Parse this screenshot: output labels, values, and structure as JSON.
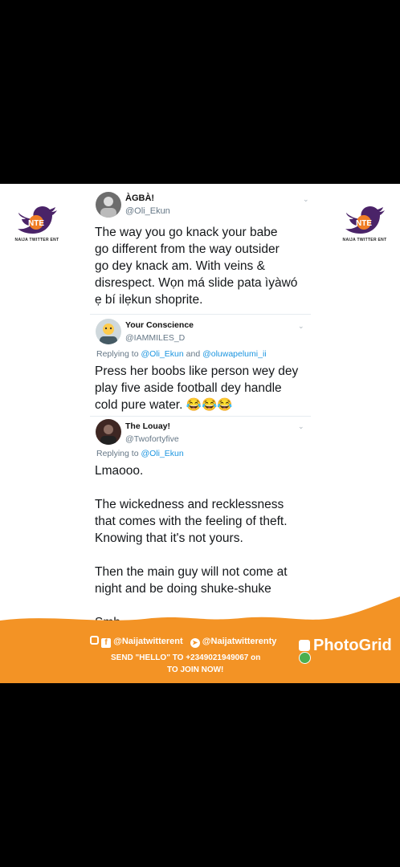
{
  "brand": {
    "logo_text": "NTE",
    "name": "NAIJA TWITTER ENT"
  },
  "tweets": [
    {
      "name": "ÀGBÀ!",
      "handle": "@Oli_Ekun",
      "text": "The way you go knack your babe\ngo different from the way outsider\ngo dey knack am. With veins &\ndisrespect. Wọn má slide pata ìyàwó\nẹ bí ilẹkun shoprite."
    },
    {
      "name": "Your Conscience",
      "handle": "@IAMMILES_D",
      "reply_prefix": "Replying to ",
      "reply_a": "@Oli_Ekun",
      "reply_and": " and ",
      "reply_b": "@oluwapelumi_ii",
      "text": "Press her boobs like person wey dey\nplay five aside football dey handle\ncold pure water. 😂😂😂"
    },
    {
      "name": "The Louay!",
      "handle": "@Twofortyfive",
      "reply_prefix": "Replying to ",
      "reply_a": "@Oli_Ekun",
      "text": "Lmaooo.\n\nThe wickedness and recklessness\nthat comes with the feeling of theft.\nKnowing that it's not yours.\n\nThen the main guy will not come at\nnight and be doing shuke-shuke\n\nSmh"
    }
  ],
  "banner": {
    "social_handle_1": "@Naijatwitterent",
    "social_handle_2": "@Naijatwitterenty",
    "cta_line1": "SEND \"HELLO\" TO +2349021949067 on",
    "cta_line2": "TO JOIN NOW!",
    "watermark": "PhotoGrid",
    "colors": {
      "orange": "#f39325",
      "white": "#ffffff"
    }
  },
  "colors": {
    "link": "#1b95e0",
    "muted": "#657786",
    "text": "#14171a",
    "logo_purple": "#4a2368",
    "logo_orange": "#f07e26"
  }
}
